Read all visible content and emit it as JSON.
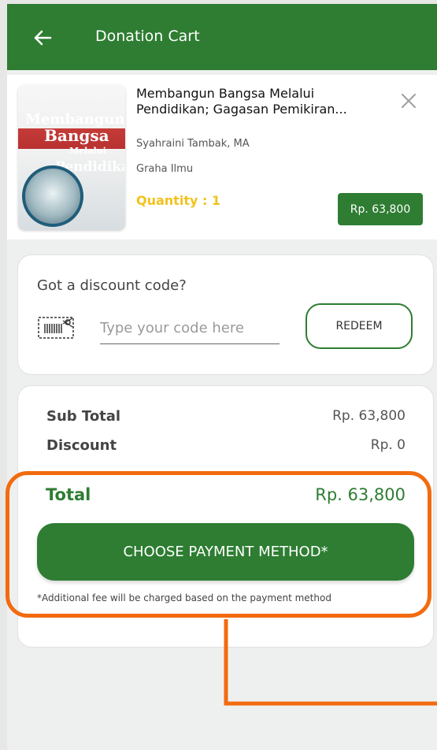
{
  "header": {
    "title": "Donation Cart"
  },
  "item": {
    "title": "Membangun Bangsa Melalui Pendidikan; Gagasan Pemikiran Pendidikan",
    "title_line1": "Membangun Bangsa Melalui",
    "title_line2": "Pendidikan; Gagasan Pemikiran...",
    "author": "Syahraini Tambak, MA",
    "publisher": "Graha Ilmu",
    "quantity": "Quantity : 1",
    "price": "Rp. 63,800",
    "cover_text": [
      "Membangun",
      "Bangsa",
      "Melalui",
      "Pendidikan"
    ]
  },
  "discount": {
    "heading": "Got a discount code?",
    "placeholder": "Type your code here",
    "button_label": "REDEEM"
  },
  "summary": {
    "subtotal_label": "Sub Total",
    "subtotal_value": "Rp. 63,800",
    "discount_label": "Discount",
    "discount_value": "Rp. 0",
    "total_label": "Total",
    "total_value": "Rp. 63,800",
    "payment_button": "CHOOSE PAYMENT METHOD*",
    "fee_note": "*Additional fee will be charged based on the payment method"
  },
  "colors": {
    "primary": "#2e7d32",
    "quantity": "#f2c21c",
    "highlight": "#f26b0f"
  },
  "icons": {
    "back": "arrow-left-icon",
    "close": "close-icon",
    "ticket": "ticket-icon"
  }
}
